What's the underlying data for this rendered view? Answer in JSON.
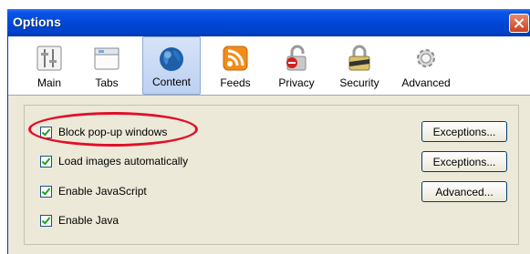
{
  "window": {
    "title": "Options"
  },
  "toolbar": {
    "tabs": [
      {
        "label": "Main",
        "icon": "main-icon"
      },
      {
        "label": "Tabs",
        "icon": "tabs-icon"
      },
      {
        "label": "Content",
        "icon": "globe-icon",
        "selected": true
      },
      {
        "label": "Feeds",
        "icon": "rss-icon"
      },
      {
        "label": "Privacy",
        "icon": "privacy-icon"
      },
      {
        "label": "Security",
        "icon": "lock-icon"
      },
      {
        "label": "Advanced",
        "icon": "gear-icon"
      }
    ]
  },
  "content": {
    "options": [
      {
        "label": "Block pop-up windows",
        "checked": true
      },
      {
        "label": "Load images automatically",
        "checked": true
      },
      {
        "label": "Enable JavaScript",
        "checked": true
      },
      {
        "label": "Enable Java",
        "checked": true
      }
    ],
    "buttons": [
      "Exceptions...",
      "Exceptions...",
      "Advanced..."
    ]
  },
  "colors": {
    "accent": "#0046d5",
    "highlight": "#e0102a"
  }
}
